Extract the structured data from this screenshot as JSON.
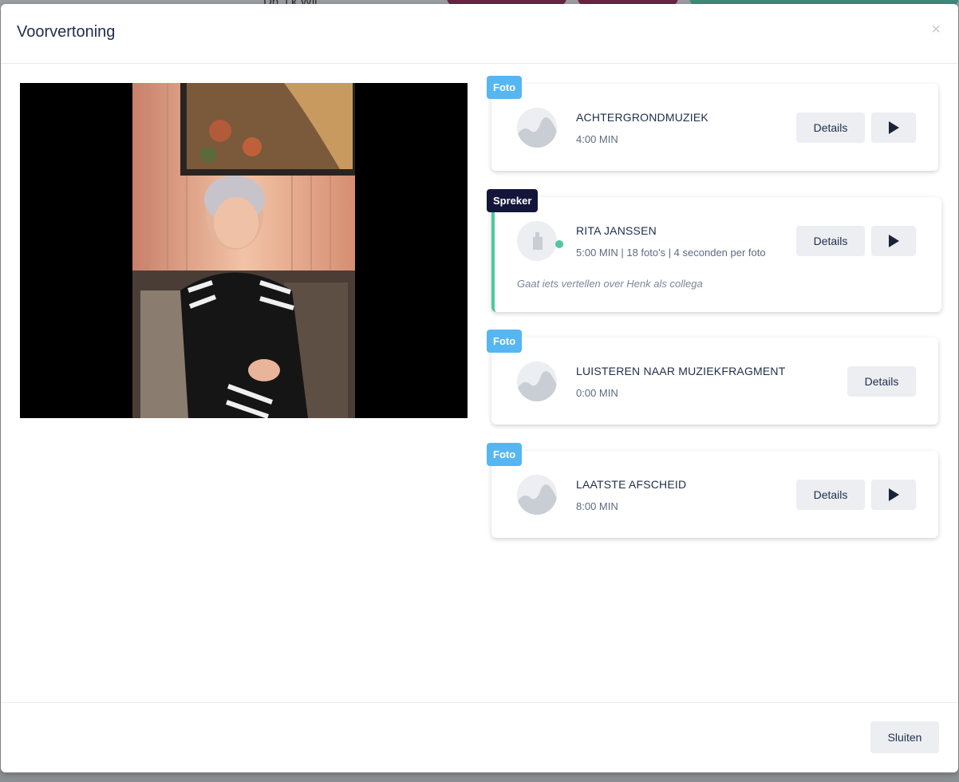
{
  "background": {
    "partial_text": "Dh..l.k Wil"
  },
  "modal": {
    "title": "Voorvertoning",
    "close_symbol": "×",
    "footer_button": "Sluiten"
  },
  "items": [
    {
      "tag": "Foto",
      "title": "ACHTERGRONDMUZIEK",
      "meta": "4:00 MIN",
      "details": "Details",
      "has_play": true,
      "icon": "image-placeholder-icon"
    },
    {
      "tag": "Spreker",
      "title": "RITA JANSSEN",
      "meta": "5:00 MIN | 18 foto's | 4 seconden per foto",
      "note": "Gaat iets vertellen over Henk als collega",
      "details": "Details",
      "has_play": true,
      "icon": "speaker-lectern-icon",
      "active": true
    },
    {
      "tag": "Foto",
      "title": "LUISTEREN NAAR MUZIEKFRAGMENT",
      "meta": "0:00 MIN",
      "details": "Details",
      "has_play": false,
      "icon": "image-placeholder-icon"
    },
    {
      "tag": "Foto",
      "title": "LAATSTE AFSCHEID",
      "meta": "8:00 MIN",
      "details": "Details",
      "has_play": true,
      "icon": "image-placeholder-icon"
    }
  ],
  "colors": {
    "foto_tag": "#55b6f2",
    "spreker_tag": "#13153a",
    "active_accent": "#4fc7a0",
    "button_bg": "#eceef2"
  }
}
